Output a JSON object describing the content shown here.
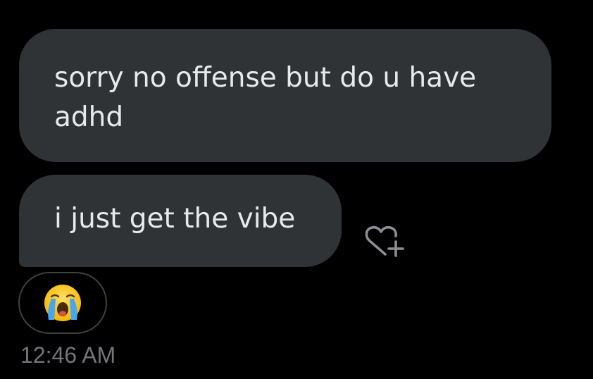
{
  "messages": [
    {
      "text": "sorry no offense but do u have adhd"
    },
    {
      "text": "i just get the vibe"
    }
  ],
  "reaction": {
    "emoji": "loudly-crying-face",
    "add_reaction_icon": "heart-plus-icon"
  },
  "timestamp": "12:46 AM",
  "colors": {
    "background": "#000000",
    "bubble": "#2f3336",
    "bubble_text": "#e7e9ea",
    "secondary_text": "#71767b",
    "pill_border": "#3e4144"
  }
}
